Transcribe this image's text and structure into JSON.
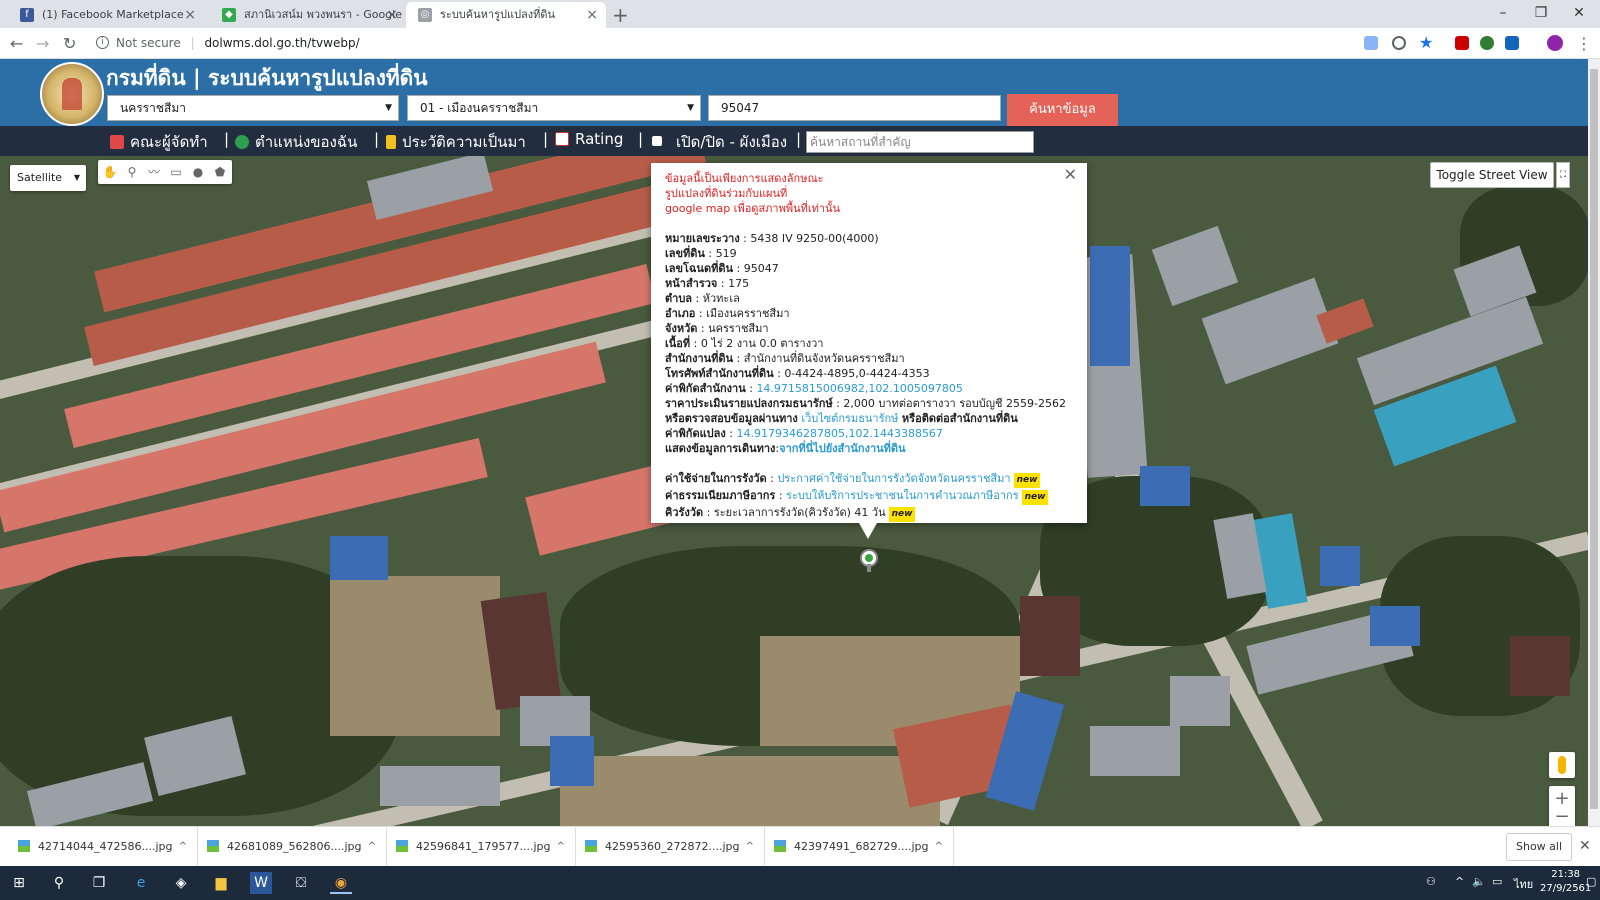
{
  "browser": {
    "tabs": [
      {
        "title": "(1) Facebook Marketplace",
        "icon": "facebook-icon",
        "active": false
      },
      {
        "title": "สภานิเวสน์ม พวงพนรา - Google M",
        "icon": "google-maps-icon",
        "active": false
      },
      {
        "title": "ระบบค้นหารูปแปลงที่ดิน",
        "icon": "globe-icon",
        "active": true
      }
    ],
    "new_tab": "+",
    "security_label": "Not secure",
    "url": "dolwms.dol.go.th/tvwebp/"
  },
  "site": {
    "title": "กรมที่ดิน | ระบบค้นหารูปแปลงที่ดิน",
    "province": "นครราชสีมา",
    "district": "01 - เมืองนครราชสีมา",
    "deed_no": "95047",
    "search_button": "ค้นหาข้อมูล",
    "nav": {
      "team": "คณะผู้จัดทำ",
      "my_location": "ตำแหน่งของฉัน",
      "history": "ประวัติความเป็นมา",
      "rating": "Rating",
      "toggle_city": "เปิด/ปิด - ผังเมือง",
      "separator": "|"
    },
    "place_search_placeholder": "ค้นหาสถานที่สำคัญ"
  },
  "map": {
    "type_selected": "Satellite",
    "toggle_street_view": "Toggle Street View",
    "zoom_in": "+",
    "zoom_out": "−"
  },
  "info": {
    "warning_1": "ข้อมูลนี้เป็นเพียงการแสดงลักษณะ",
    "warning_2": "รูปแปลงที่ดินร่วมกับแผนที่",
    "warning_3": "google map เพื่อดูสภาพพื้นที่เท่านั้น",
    "rows": {
      "sheet_label": "หมายเลขระวาง",
      "sheet_value": "5438 IV 9250-00(4000)",
      "parcel_label": "เลขที่ดิน",
      "parcel_value": "519",
      "deed_label": "เลขโฉนดที่ดิน",
      "deed_value": "95047",
      "survey_label": "หน้าสำรวจ",
      "survey_value": "175",
      "tambon_label": "ตำบล",
      "tambon_value": "หัวทะเล",
      "amphoe_label": "อำเภอ",
      "amphoe_value": "เมืองนครราชสีมา",
      "province_label": "จังหวัด",
      "province_value": "นครราชสีมา",
      "area_label": "เนื้อที่",
      "area_value": "0 ไร่ 2 งาน 0.0 ตารางวา",
      "office_label": "สำนักงานที่ดิน",
      "office_value": "สำนักงานที่ดินจังหวัดนครราชสีมา",
      "phone_label": "โทรศัพท์สำนักงานที่ดิน",
      "phone_value": "0-4424-4895,0-4424-4353",
      "office_coord_label": "ค่าพิกัดสำนักงาน",
      "office_coord_value": "14.9715815006982,102.1005097805",
      "price_label": "ราคาประเมินรายแปลงกรมธนารักษ์",
      "price_value": "2,000 บาทต่อตารางวา รอบบัญชี 2559-2562",
      "check_prefix": "หรือตรวจสอบข้อมูลผ่านทาง",
      "check_link": "เว็บไซต์กรมธนารักษ์",
      "check_suffix": "หรือติดต่อสำนักงานที่ดิน",
      "parcel_coord_label": "ค่าพิกัดแปลง",
      "parcel_coord_value": "14.9179346287805,102.1443388567",
      "route_label": "แสดงข้อมูลการเดินทาง",
      "route_link": "จากที่นี่ไปยังสำนักงานที่ดิน",
      "fee_label": "ค่าใช้จ่ายในการรังวัด",
      "fee_link": "ประกาศค่าใช้จ่ายในการรังวัดจังหวัดนครราชสีมา",
      "tax_label": "ค่าธรรมเนียมภาษีอากร",
      "tax_link": "ระบบให้บริการประชาชนในการคำนวณภาษีอากร",
      "queue_label": "คิวรังวัด",
      "queue_value": "ระยะเวลาการรังวัด(คิวรังวัด) 41 วัน",
      "new_badge": "new",
      "sep": " : "
    }
  },
  "downloads": {
    "items": [
      "42714044_472586....jpg",
      "42681089_562806....jpg",
      "42596841_179577....jpg",
      "42595360_272872....jpg",
      "42397491_682729....jpg"
    ],
    "show_all": "Show all"
  },
  "taskbar": {
    "time": "21:38",
    "date": "27/9/2561",
    "lang": "ไทย"
  },
  "colors": {
    "header_blue": "#2b6fa6",
    "nav_dark": "#222d3f",
    "search_red": "#e56258",
    "warning_red": "#e02020",
    "link_blue": "#2a9bd0",
    "new_yellow": "#ffe100"
  }
}
